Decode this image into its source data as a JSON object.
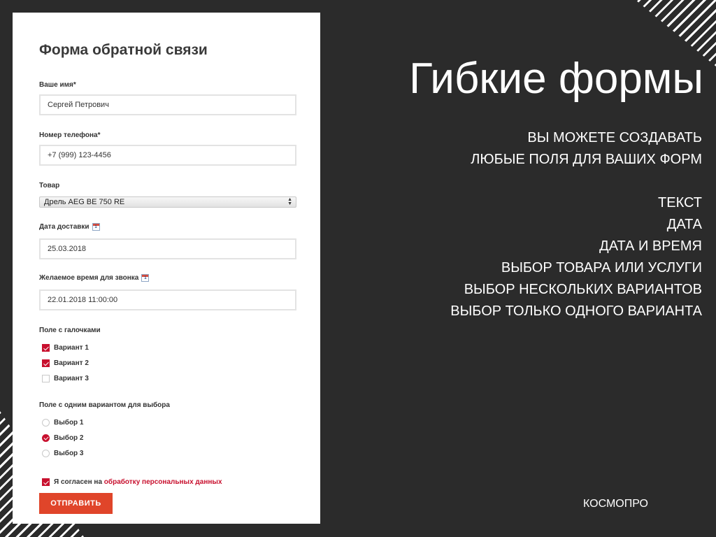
{
  "form": {
    "title": "Форма обратной связи",
    "name_label": "Ваше имя*",
    "name_value": "Сергей Петрович",
    "phone_label": "Номер телефона*",
    "phone_value": "+7 (999) 123-4456",
    "product_label": "Товар",
    "product_selected": "Дрель AEG BE 750 RE",
    "delivery_label": "Дата доставки",
    "delivery_value": "25.03.2018",
    "call_time_label": "Желаемое время для звонка",
    "call_time_value": "22.01.2018 11:00:00",
    "calendar_icon_text": "1",
    "checkbox_group_label": "Поле с галочками",
    "checkboxes": [
      {
        "label": "Вариант 1",
        "checked": true
      },
      {
        "label": "Вариант 2",
        "checked": true
      },
      {
        "label": "Вариант 3",
        "checked": false
      }
    ],
    "radio_group_label": "Поле с одним вариантом для выбора",
    "radios": [
      {
        "label": "Выбор 1",
        "selected": false
      },
      {
        "label": "Выбор 2",
        "selected": true
      },
      {
        "label": "Выбор 3",
        "selected": false
      }
    ],
    "consent_text": "Я согласен на ",
    "consent_link": "обработку персональных данных",
    "consent_checked": true,
    "submit_label": "ОТПРАВИТЬ"
  },
  "hero": {
    "title": "Гибкие формы",
    "intro": [
      "ВЫ МОЖЕТЕ СОЗДАВАТЬ",
      "ЛЮБЫЕ ПОЛЯ ДЛЯ ВАШИХ ФОРМ"
    ],
    "features": [
      "ТЕКСТ",
      "ДАТА",
      "ДАТА И ВРЕМЯ",
      "ВЫБОР ТОВАРА ИЛИ УСЛУГИ",
      "ВЫБОР НЕСКОЛЬКИХ ВАРИАНТОВ",
      "ВЫБОР ТОЛЬКО ОДНОГО ВАРИАНТА"
    ]
  },
  "brand": "КОСМОПРО",
  "colors": {
    "background": "#2b2b2b",
    "accent_red": "#c8102e",
    "button_orange": "#e0452a"
  }
}
